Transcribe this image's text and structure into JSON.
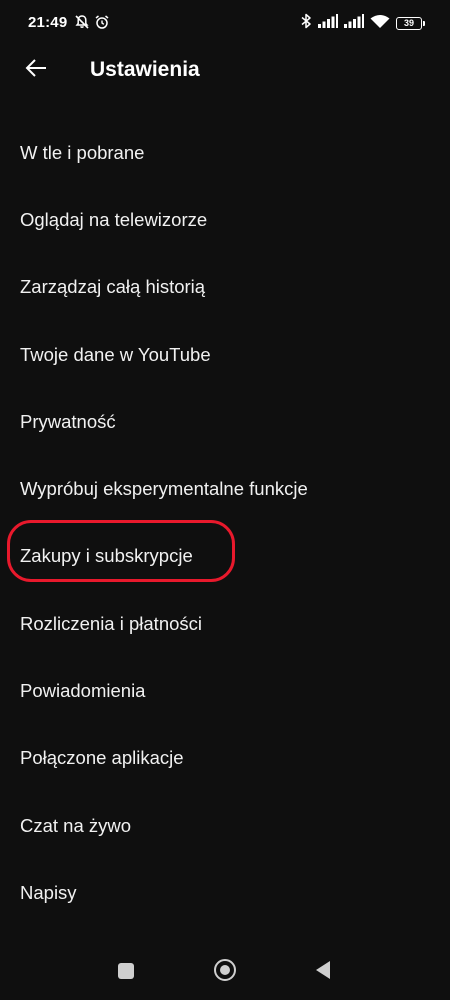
{
  "status_bar": {
    "time": "21:49",
    "left_icons": [
      "bell-off-icon",
      "alarm-icon"
    ],
    "right_icons": [
      "bluetooth-icon",
      "signal-icon",
      "signal-icon",
      "wifi-icon"
    ],
    "battery_level": "39"
  },
  "header": {
    "back_icon": "arrow-left-icon",
    "title": "Ustawienia"
  },
  "settings": {
    "items": [
      {
        "label": "W tle i pobrane"
      },
      {
        "label": "Oglądaj na telewizorze"
      },
      {
        "label": "Zarządzaj całą historią"
      },
      {
        "label": "Twoje dane w YouTube"
      },
      {
        "label": "Prywatność"
      },
      {
        "label": "Wypróbuj eksperymentalne funkcje"
      },
      {
        "label": "Zakupy i subskrypcje"
      },
      {
        "label": "Rozliczenia i płatności"
      },
      {
        "label": "Powiadomienia"
      },
      {
        "label": "Połączone aplikacje"
      },
      {
        "label": "Czat na żywo"
      },
      {
        "label": "Napisy"
      }
    ],
    "highlighted_index": 6,
    "highlight_color": "#e8192c"
  },
  "nav_bar": {
    "icons": [
      "recents-icon",
      "home-icon",
      "back-triangle-icon"
    ]
  },
  "colors": {
    "background": "#0f0f0f",
    "text": "#f1f1f1"
  }
}
